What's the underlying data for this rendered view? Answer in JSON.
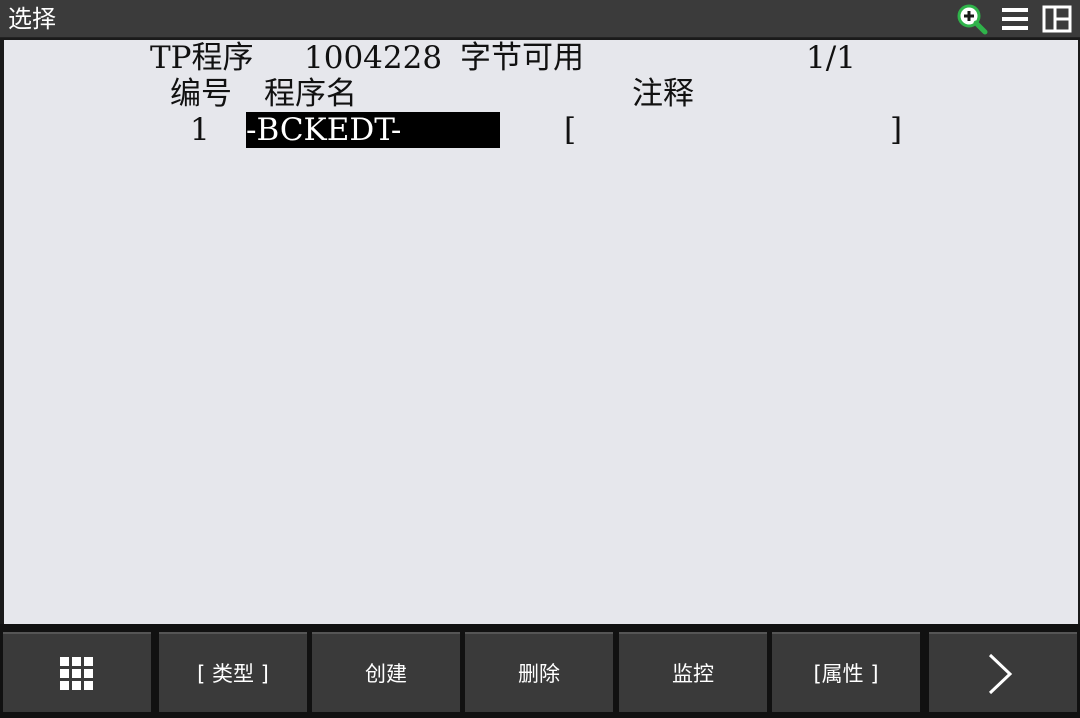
{
  "title_bar": {
    "title": "选择",
    "icons": [
      "zoom-in-icon",
      "menu-icon",
      "layout-icon"
    ],
    "accent_color": "#2fb34a"
  },
  "content": {
    "header": {
      "type": "TP程序",
      "bytes_value": "1004228",
      "bytes_label": "字节可用",
      "page": "1/1"
    },
    "columns": {
      "number": "编号",
      "name": "程序名",
      "comment": "注释"
    },
    "rows": [
      {
        "number": "1",
        "name": "-BCKEDT-",
        "comment_open": "[",
        "comment_close": "]",
        "selected": true
      }
    ]
  },
  "function_keys": {
    "grid_icon": "grid-icon",
    "f1": "[ 类型 ]",
    "f2": "创建",
    "f3": "删除",
    "f4": "监控",
    "f5": "[属性 ]",
    "next_icon": "chevron-right-icon"
  }
}
